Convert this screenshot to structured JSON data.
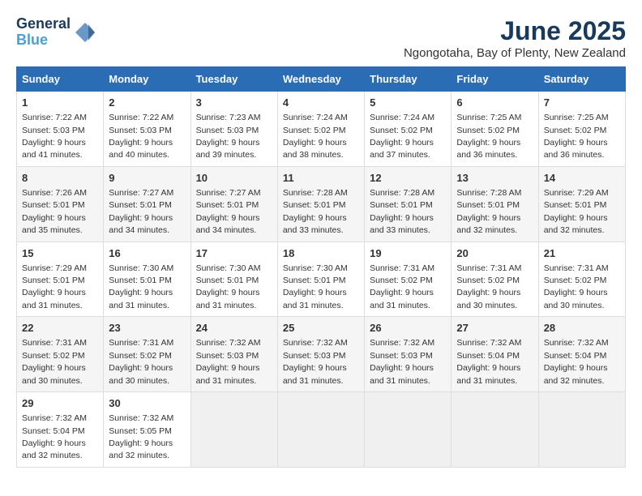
{
  "logo": {
    "line1": "General",
    "line2": "Blue"
  },
  "title": "June 2025",
  "subtitle": "Ngongotaha, Bay of Plenty, New Zealand",
  "headers": [
    "Sunday",
    "Monday",
    "Tuesday",
    "Wednesday",
    "Thursday",
    "Friday",
    "Saturday"
  ],
  "weeks": [
    [
      {
        "day": "1",
        "sunrise": "7:22 AM",
        "sunset": "5:03 PM",
        "daylight": "9 hours and 41 minutes."
      },
      {
        "day": "2",
        "sunrise": "7:22 AM",
        "sunset": "5:03 PM",
        "daylight": "9 hours and 40 minutes."
      },
      {
        "day": "3",
        "sunrise": "7:23 AM",
        "sunset": "5:03 PM",
        "daylight": "9 hours and 39 minutes."
      },
      {
        "day": "4",
        "sunrise": "7:24 AM",
        "sunset": "5:02 PM",
        "daylight": "9 hours and 38 minutes."
      },
      {
        "day": "5",
        "sunrise": "7:24 AM",
        "sunset": "5:02 PM",
        "daylight": "9 hours and 37 minutes."
      },
      {
        "day": "6",
        "sunrise": "7:25 AM",
        "sunset": "5:02 PM",
        "daylight": "9 hours and 36 minutes."
      },
      {
        "day": "7",
        "sunrise": "7:25 AM",
        "sunset": "5:02 PM",
        "daylight": "9 hours and 36 minutes."
      }
    ],
    [
      {
        "day": "8",
        "sunrise": "7:26 AM",
        "sunset": "5:01 PM",
        "daylight": "9 hours and 35 minutes."
      },
      {
        "day": "9",
        "sunrise": "7:27 AM",
        "sunset": "5:01 PM",
        "daylight": "9 hours and 34 minutes."
      },
      {
        "day": "10",
        "sunrise": "7:27 AM",
        "sunset": "5:01 PM",
        "daylight": "9 hours and 34 minutes."
      },
      {
        "day": "11",
        "sunrise": "7:28 AM",
        "sunset": "5:01 PM",
        "daylight": "9 hours and 33 minutes."
      },
      {
        "day": "12",
        "sunrise": "7:28 AM",
        "sunset": "5:01 PM",
        "daylight": "9 hours and 33 minutes."
      },
      {
        "day": "13",
        "sunrise": "7:28 AM",
        "sunset": "5:01 PM",
        "daylight": "9 hours and 32 minutes."
      },
      {
        "day": "14",
        "sunrise": "7:29 AM",
        "sunset": "5:01 PM",
        "daylight": "9 hours and 32 minutes."
      }
    ],
    [
      {
        "day": "15",
        "sunrise": "7:29 AM",
        "sunset": "5:01 PM",
        "daylight": "9 hours and 31 minutes."
      },
      {
        "day": "16",
        "sunrise": "7:30 AM",
        "sunset": "5:01 PM",
        "daylight": "9 hours and 31 minutes."
      },
      {
        "day": "17",
        "sunrise": "7:30 AM",
        "sunset": "5:01 PM",
        "daylight": "9 hours and 31 minutes."
      },
      {
        "day": "18",
        "sunrise": "7:30 AM",
        "sunset": "5:01 PM",
        "daylight": "9 hours and 31 minutes."
      },
      {
        "day": "19",
        "sunrise": "7:31 AM",
        "sunset": "5:02 PM",
        "daylight": "9 hours and 31 minutes."
      },
      {
        "day": "20",
        "sunrise": "7:31 AM",
        "sunset": "5:02 PM",
        "daylight": "9 hours and 30 minutes."
      },
      {
        "day": "21",
        "sunrise": "7:31 AM",
        "sunset": "5:02 PM",
        "daylight": "9 hours and 30 minutes."
      }
    ],
    [
      {
        "day": "22",
        "sunrise": "7:31 AM",
        "sunset": "5:02 PM",
        "daylight": "9 hours and 30 minutes."
      },
      {
        "day": "23",
        "sunrise": "7:31 AM",
        "sunset": "5:02 PM",
        "daylight": "9 hours and 30 minutes."
      },
      {
        "day": "24",
        "sunrise": "7:32 AM",
        "sunset": "5:03 PM",
        "daylight": "9 hours and 31 minutes."
      },
      {
        "day": "25",
        "sunrise": "7:32 AM",
        "sunset": "5:03 PM",
        "daylight": "9 hours and 31 minutes."
      },
      {
        "day": "26",
        "sunrise": "7:32 AM",
        "sunset": "5:03 PM",
        "daylight": "9 hours and 31 minutes."
      },
      {
        "day": "27",
        "sunrise": "7:32 AM",
        "sunset": "5:04 PM",
        "daylight": "9 hours and 31 minutes."
      },
      {
        "day": "28",
        "sunrise": "7:32 AM",
        "sunset": "5:04 PM",
        "daylight": "9 hours and 32 minutes."
      }
    ],
    [
      {
        "day": "29",
        "sunrise": "7:32 AM",
        "sunset": "5:04 PM",
        "daylight": "9 hours and 32 minutes."
      },
      {
        "day": "30",
        "sunrise": "7:32 AM",
        "sunset": "5:05 PM",
        "daylight": "9 hours and 32 minutes."
      },
      null,
      null,
      null,
      null,
      null
    ]
  ]
}
